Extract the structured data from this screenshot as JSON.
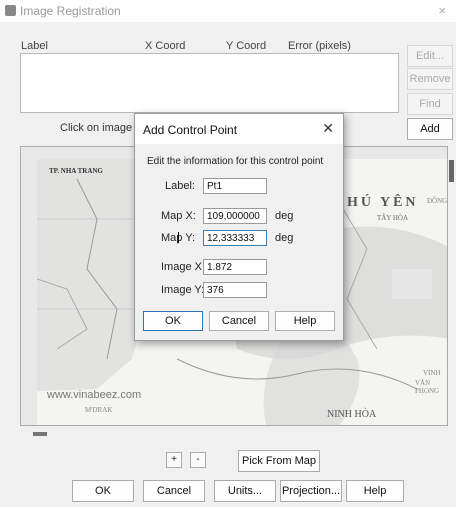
{
  "window": {
    "title": "Image Registration",
    "close": "×"
  },
  "columns": [
    "Label",
    "X Coord",
    "Y Coord",
    "Error (pixels)"
  ],
  "side_buttons": [
    "Edit...",
    "Remove",
    "Find",
    "Add"
  ],
  "hint": "Click on image or m",
  "map_labels": {
    "nha_trang": "TP. NHA TRANG",
    "phu_yen": "HÚ YÊN",
    "tay_hoa": "TÂY HÒA",
    "vinh": "VINH",
    "van_phong": "VĂN PHONG",
    "ninh_hoa": "NINH HÒA",
    "watermark": "www.vinabeez.com",
    "khanh": "M'DRAK",
    "dong": "ĐÔNG"
  },
  "zoom_plus": "+",
  "zoom_minus": "-",
  "pick_from_map": "Pick From Map",
  "bottom_buttons": [
    "OK",
    "Cancel",
    "Units...",
    "Projection...",
    "Help"
  ],
  "dialog": {
    "title": "Add Control Point",
    "close": "✕",
    "info": "Edit the information for this control point",
    "label_label": "Label:",
    "label_value": "Pt1",
    "mapx_label": "Map X:",
    "mapx_value": "109,000000",
    "mapx_unit": "deg",
    "mapy_label": "Map Y:",
    "mapy_value": "12,333333",
    "mapy_unit": "deg",
    "imgx_label": "Image X:",
    "imgx_value": "1.872",
    "imgy_label": "Image Y:",
    "imgy_value": "376",
    "ok": "OK",
    "cancel": "Cancel",
    "help": "Help"
  }
}
